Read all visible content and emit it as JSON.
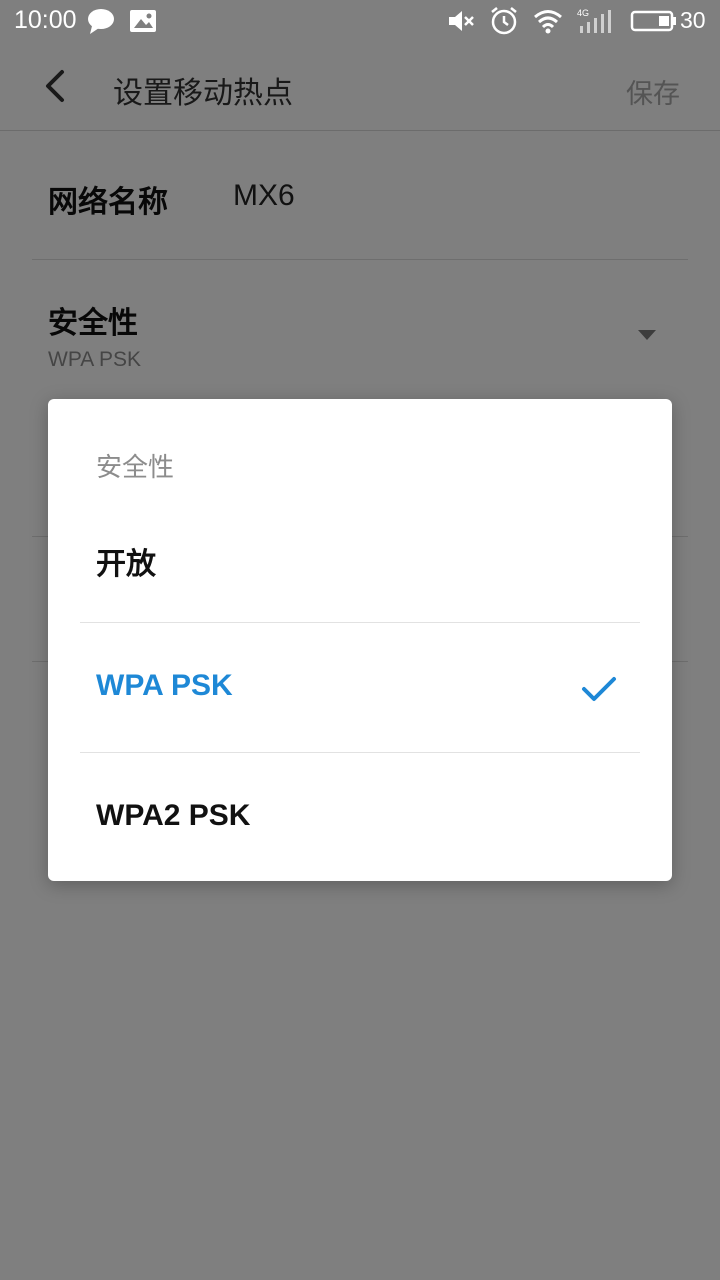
{
  "status_bar": {
    "time": "10:00",
    "battery_level": "30",
    "icons": [
      "chat-bubble-icon",
      "image-notification-icon",
      "mute-icon",
      "alarm-icon",
      "wifi-icon",
      "signal-4g-icon",
      "battery-icon"
    ],
    "network_type": "4G"
  },
  "appbar": {
    "title": "设置移动热点",
    "save_label": "保存"
  },
  "settings": {
    "ssid_label": "网络名称",
    "ssid_value": "MX6",
    "security_label": "安全性",
    "security_value": "WPA PSK"
  },
  "dialog": {
    "title": "安全性",
    "options": [
      {
        "label": "开放",
        "selected": false
      },
      {
        "label": "WPA PSK",
        "selected": true
      },
      {
        "label": "WPA2 PSK",
        "selected": false
      }
    ]
  },
  "colors": {
    "accent": "#1e88d6",
    "scrim": "#000000",
    "text_primary": "#111111",
    "text_secondary": "#8c8c8c"
  }
}
